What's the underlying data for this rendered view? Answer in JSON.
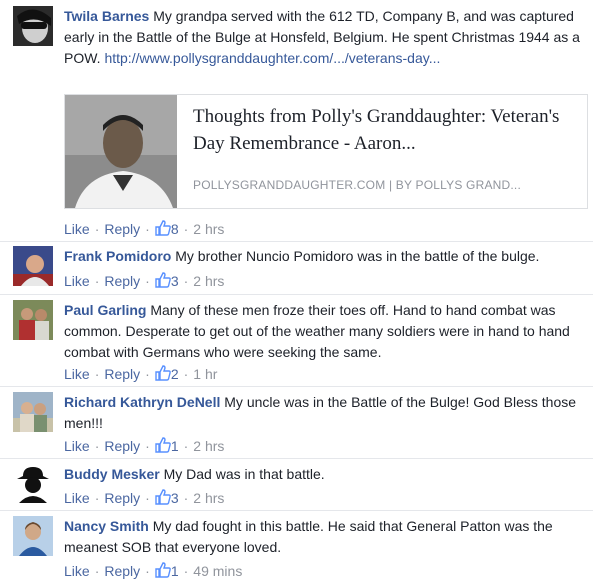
{
  "actions": {
    "like": "Like",
    "reply": "Reply",
    "sep": "·"
  },
  "comments": [
    {
      "author": "Twila Barnes",
      "text": " My grandpa served with the 612 TD, Company B, and was captured early in the Battle of the Bulge at Honsfeld, Belgium. He spent Christmas 1944 as a POW. ",
      "link": "http://www.pollysgranddaughter.com/.../veterans-day...",
      "likes": "8",
      "time": "2 hrs",
      "card": {
        "title": "Thoughts from Polly's Granddaughter: Veteran's Day Remembrance - Aaron...",
        "domain": "POLLYSGRANDDAUGHTER.COM | BY POLLYS GRAND..."
      }
    },
    {
      "author": "Frank Pomidoro",
      "text": " My brother Nuncio Pomidoro was in the battle of the bulge.",
      "likes": "3",
      "time": "2 hrs"
    },
    {
      "author": "Paul Garling",
      "text": " Many of these men froze their toes off. Hand to hand combat was common. Desperate to get out of the weather many soldiers were in hand to hand combat with Germans who were seeking the same.",
      "likes": "2",
      "time": "1 hr"
    },
    {
      "author": "Richard Kathryn DeNell",
      "text": " My uncle was in the Battle of the Bulge! God Bless those men!!!",
      "likes": "1",
      "time": "2 hrs"
    },
    {
      "author": "Buddy Mesker",
      "text": " My Dad was in that battle.",
      "likes": "3",
      "time": "2 hrs"
    },
    {
      "author": "Nancy Smith",
      "text": " My dad fought in this battle. He said that General Patton was the meanest SOB that everyone loved.",
      "likes": "1",
      "time": "49 mins"
    }
  ],
  "colors": {
    "author": "#365899",
    "meta": "#90949c",
    "action": "#4b67a1",
    "like_icon": "#5890ff"
  },
  "icons": {
    "like": "thumbs-up-icon"
  }
}
